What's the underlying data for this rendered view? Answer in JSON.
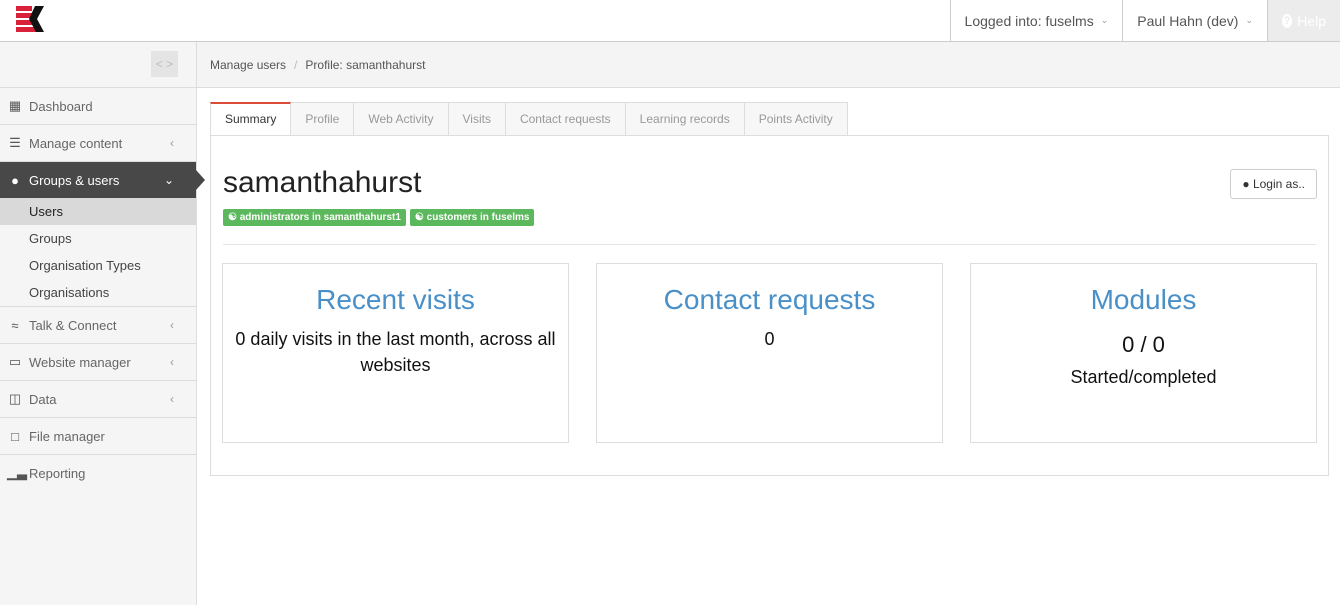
{
  "header": {
    "logged_into": "Logged into: fuselms",
    "user": "Paul Hahn (dev)",
    "help": "Help"
  },
  "sidebar": {
    "toggle": "< >",
    "items": [
      {
        "label": "Dashboard",
        "icon": "dashboard-icon"
      },
      {
        "label": "Manage content",
        "icon": "layers-icon"
      },
      {
        "label": "Groups & users",
        "icon": "user-icon"
      },
      {
        "label": "Talk & Connect",
        "icon": "wifi-icon"
      },
      {
        "label": "Website manager",
        "icon": "laptop-icon"
      },
      {
        "label": "Data",
        "icon": "database-icon"
      },
      {
        "label": "File manager",
        "icon": "file-icon"
      },
      {
        "label": "Reporting",
        "icon": "bar-chart-icon"
      }
    ],
    "subitems": [
      "Users",
      "Groups",
      "Organisation Types",
      "Organisations"
    ]
  },
  "breadcrumb": [
    "Manage users",
    "Profile: samanthahurst"
  ],
  "tabs": [
    "Summary",
    "Profile",
    "Web Activity",
    "Visits",
    "Contact requests",
    "Learning records",
    "Points Activity"
  ],
  "profile": {
    "username": "samanthahurst",
    "badges": [
      "administrators in samanthahurst1",
      "customers in fuselms"
    ],
    "login_as": "Login as.."
  },
  "cards": [
    {
      "title": "Recent visits",
      "text": "0 daily visits in the last month, across all websites"
    },
    {
      "title": "Contact requests",
      "text": "0"
    },
    {
      "title": "Modules",
      "value": "0 / 0",
      "text": "Started/completed"
    }
  ],
  "colors": {
    "accent": "#dd4b39",
    "badge": "#5cb85c",
    "link": "#4a90c8",
    "active_menu": "#484848"
  }
}
